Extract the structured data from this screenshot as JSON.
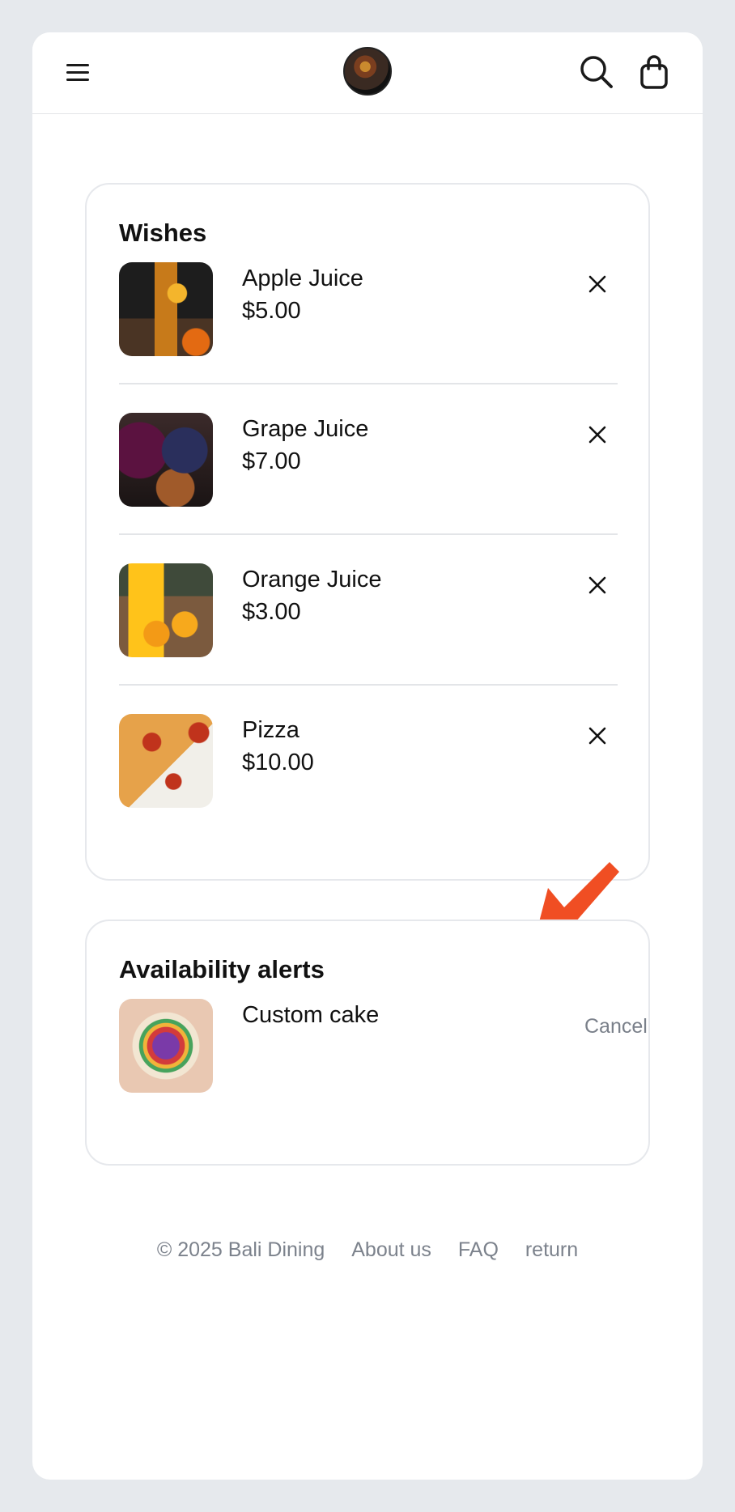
{
  "header": {
    "menu_icon": "hamburger-menu-icon",
    "logo_icon": "restaurant-logo",
    "search_icon": "search-icon",
    "cart_icon": "shopping-bag-icon"
  },
  "wishes": {
    "title": "Wishes",
    "items": [
      {
        "name": "Apple Juice",
        "price": "$5.00",
        "image": "apple-juice-image"
      },
      {
        "name": "Grape Juice",
        "price": "$7.00",
        "image": "grape-juice-image"
      },
      {
        "name": "Orange Juice",
        "price": "$3.00",
        "image": "orange-juice-image"
      },
      {
        "name": "Pizza",
        "price": "$10.00",
        "image": "pizza-image"
      }
    ]
  },
  "alerts": {
    "title": "Availability alerts",
    "items": [
      {
        "name": "Custom cake",
        "action": "Cancel",
        "image": "custom-cake-image"
      }
    ]
  },
  "footer": {
    "copyright": "© 2025 Bali Dining",
    "links": [
      "About us",
      "FAQ",
      "return"
    ]
  },
  "colors": {
    "accent_arrow": "#f04e23",
    "muted_text": "#7c828c",
    "border": "#e6e8ec"
  }
}
